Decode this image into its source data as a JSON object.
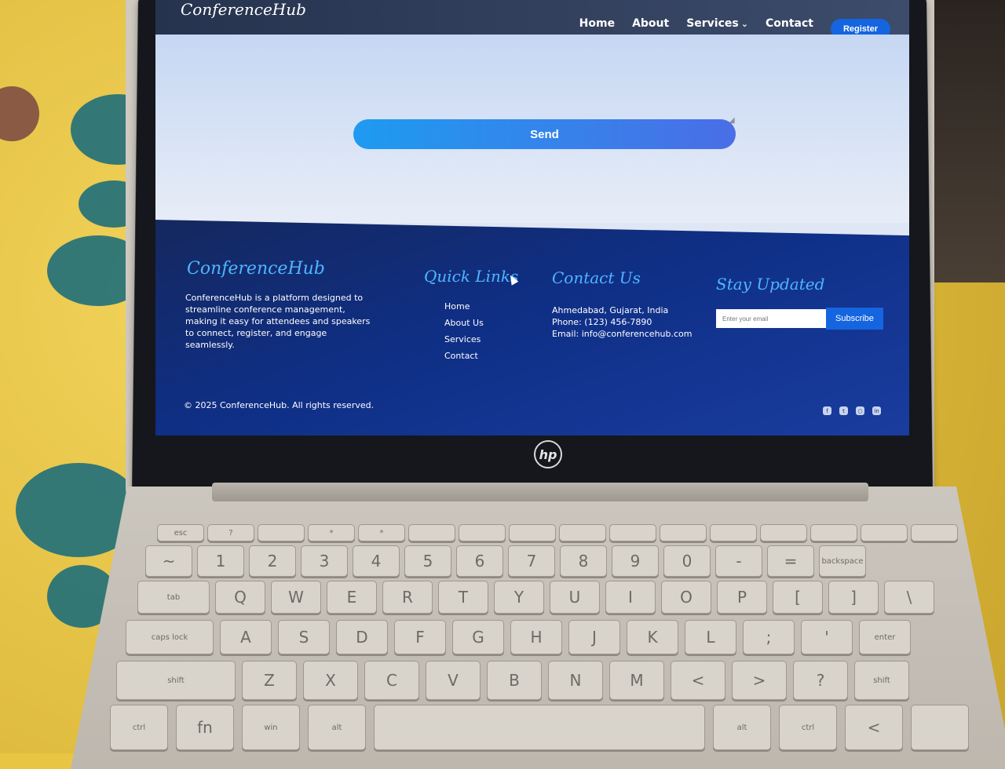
{
  "site": {
    "brand": "ConferenceHub",
    "nav": {
      "home": "Home",
      "about": "About",
      "services": "Services",
      "contact": "Contact",
      "register": "Register"
    },
    "form": {
      "send_label": "Send"
    },
    "footer": {
      "brand": "ConferenceHub",
      "description": "ConferenceHub is a platform designed to streamline conference management, making it easy for attendees and speakers to connect, register, and engage seamlessly.",
      "quick_links_title": "Quick Links",
      "quick_links": [
        "Home",
        "About Us",
        "Services",
        "Contact"
      ],
      "contact_title": "Contact Us",
      "contact_lines": [
        "Ahmedabad, Gujarat, India",
        "Phone: (123) 456-7890",
        "Email: info@conferencehub.com"
      ],
      "stay_title": "Stay Updated",
      "email_placeholder": "Enter your email",
      "subscribe_label": "Subscribe",
      "copyright": "© 2025 ConferenceHub. All rights reserved.",
      "socials": [
        "facebook-icon",
        "twitter-icon",
        "instagram-icon",
        "linkedin-icon"
      ]
    }
  },
  "device": {
    "logo": "hp",
    "keys": {
      "row1": [
        "esc",
        "?",
        "",
        "*",
        "*",
        "",
        "",
        "",
        "",
        "",
        "",
        "",
        "",
        "",
        "",
        ""
      ],
      "row2": [
        "~",
        "1",
        "2",
        "3",
        "4",
        "5",
        "6",
        "7",
        "8",
        "9",
        "0",
        "-",
        "=",
        "backspace"
      ],
      "row3": [
        "tab",
        "Q",
        "W",
        "E",
        "R",
        "T",
        "Y",
        "U",
        "I",
        "O",
        "P",
        "[",
        "]",
        "\\"
      ],
      "row4": [
        "caps lock",
        "A",
        "S",
        "D",
        "F",
        "G",
        "H",
        "J",
        "K",
        "L",
        ";",
        "'",
        "enter"
      ],
      "row5": [
        "shift",
        "Z",
        "X",
        "C",
        "V",
        "B",
        "N",
        "M",
        "<",
        ">",
        "?",
        "shift"
      ],
      "row6": [
        "ctrl",
        "fn",
        "win",
        "alt",
        "",
        "alt",
        "ctrl",
        "<",
        ""
      ]
    }
  },
  "colors": {
    "accent": "#1565e0",
    "footer_bg": "#0f2f86",
    "title_color": "#4fb6ff"
  }
}
